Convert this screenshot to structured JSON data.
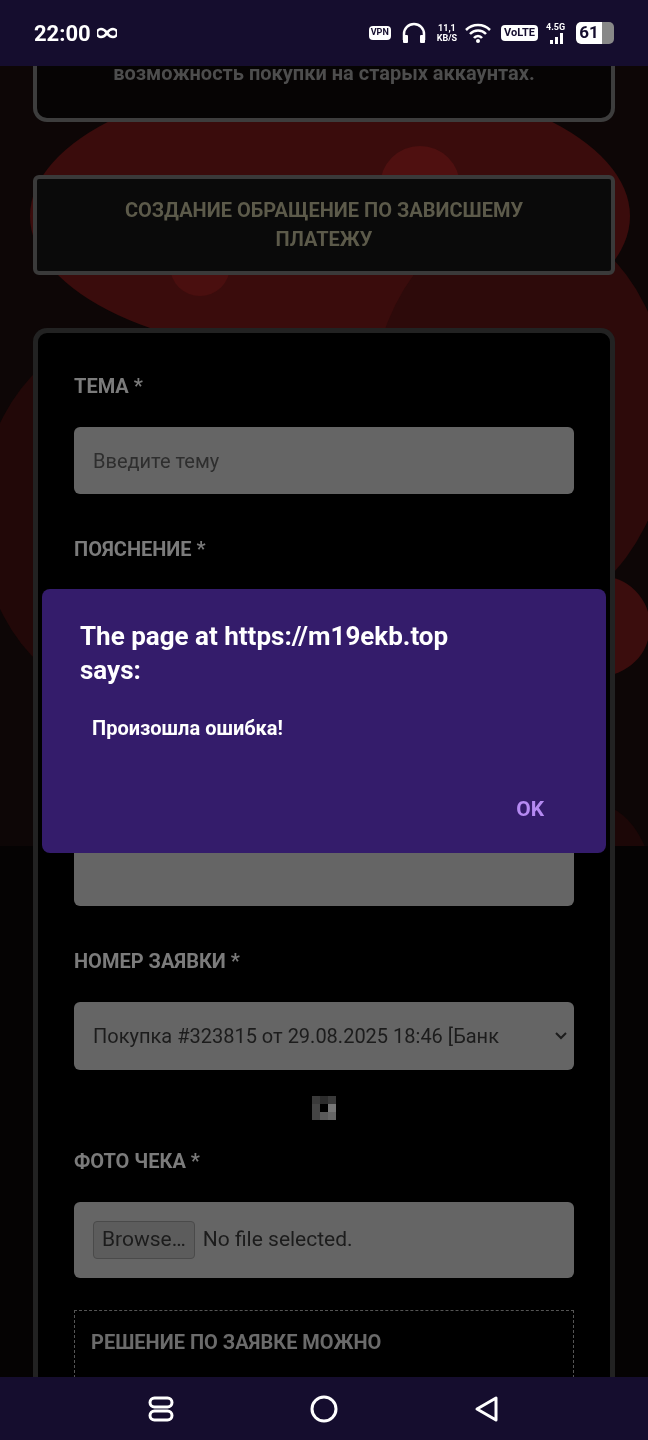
{
  "status_bar": {
    "time": "22:00",
    "vpn": "VPN",
    "speed_value": "11,1",
    "speed_unit": "KB/S",
    "volte": "VoLTE",
    "network": "4.5G",
    "battery": "61"
  },
  "notice": {
    "text": "возможность покупки на старых аккаунтах."
  },
  "action_button": {
    "label": "СОЗДАНИЕ ОБРАЩЕНИЕ ПО ЗАВИСШЕМУ ПЛАТЕЖУ"
  },
  "form": {
    "fields": [
      {
        "kind": "text",
        "label": "ТЕМА *",
        "placeholder": "Введите тему"
      },
      {
        "kind": "textarea",
        "label": "ПОЯСНЕНИЕ *"
      },
      {
        "kind": "select",
        "label": "НОМЕР ЗАЯВКИ *",
        "value": "Покупка #323815 от 29.08.2025 18:46 [Банк"
      },
      {
        "kind": "loader"
      },
      {
        "kind": "file",
        "label": "ФОТО ЧЕКА *",
        "button": "Browse…",
        "value": "No file selected."
      }
    ],
    "note": "РЕШЕНИЕ ПО ЗАЯВКЕ МОЖНО"
  },
  "dialog": {
    "title": "The page at https://m19ekb.top says:",
    "message": "Произошла ошибка!",
    "button": "OK"
  }
}
